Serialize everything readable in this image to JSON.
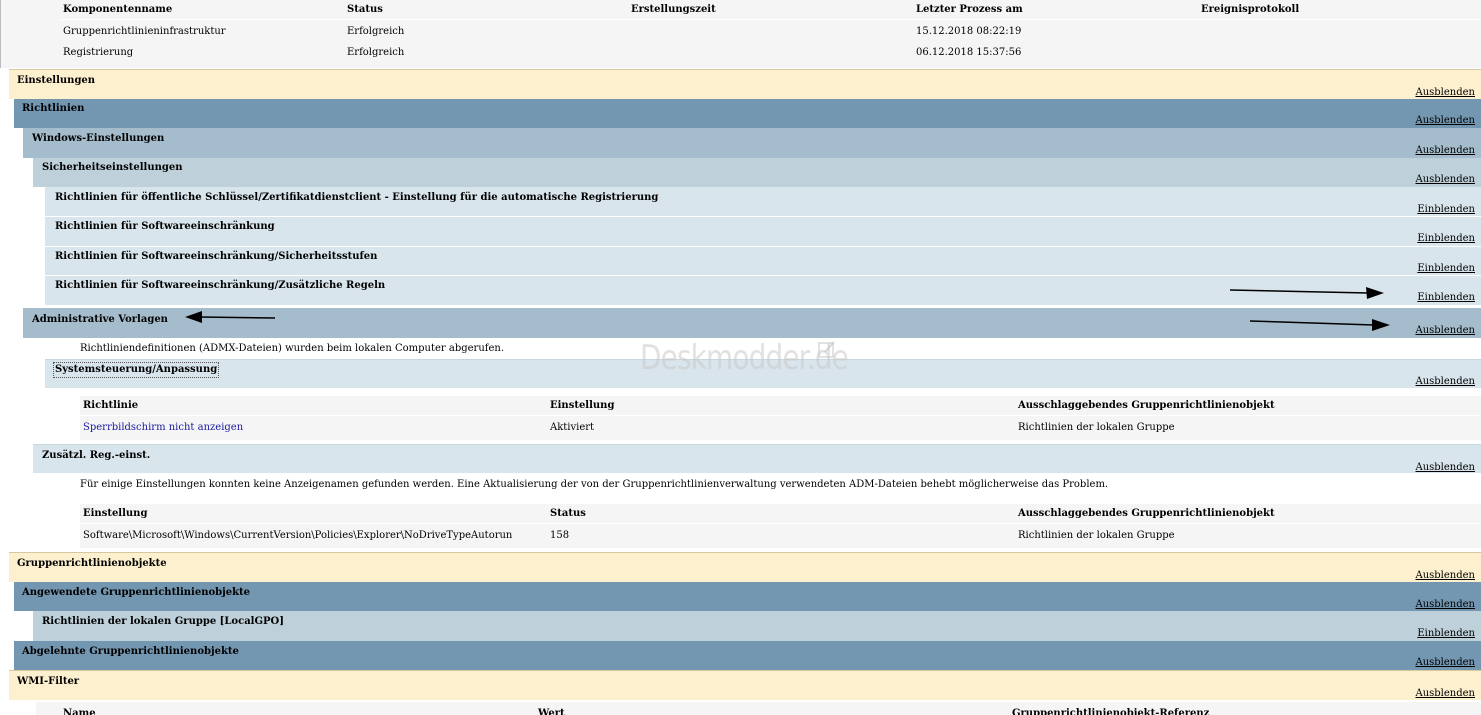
{
  "components": {
    "headers": [
      "Komponentenname",
      "Status",
      "Erstellungszeit",
      "Letzter Prozess am",
      "Ereignisprotokoll"
    ],
    "rows": [
      [
        "Gruppenrichtlinieninfrastruktur",
        "Erfolgreich",
        "",
        "15.12.2018 08:22:19",
        ""
      ],
      [
        "Registrierung",
        "Erfolgreich",
        "",
        "06.12.2018 15:37:56",
        ""
      ]
    ]
  },
  "toggles": {
    "hide": "Ausblenden",
    "show": "Einblenden"
  },
  "sections": {
    "einstellungen": "Einstellungen",
    "richtlinien": "Richtlinien",
    "windows_einstellungen": "Windows-Einstellungen",
    "sicherheitseinstellungen": "Sicherheitseinstellungen",
    "sub1": "Richtlinien für öffentliche Schlüssel/Zertifikatdienstclient - Einstellung für die automatische Registrierung",
    "sub2": "Richtlinien für Softwareeinschränkung",
    "sub3": "Richtlinien für Softwareeinschränkung/Sicherheitsstufen",
    "sub4": "Richtlinien für Softwareeinschränkung/Zusätzliche Regeln",
    "admin_vorlagen": "Administrative Vorlagen",
    "admx_info": "Richtliniendefinitionen (ADMX-Dateien) wurden beim lokalen Computer abgerufen.",
    "systemsteuerung": "Systemsteuerung/Anpassung",
    "zusaetzl": "Zusätzl. Reg.-einst.",
    "zusaetzl_info": "Für einige Einstellungen konnten keine Anzeigenamen gefunden werden. Eine Aktualisierung der von der Gruppenrichtlinienverwaltung verwendeten ADM-Dateien behebt möglicherweise das Problem.",
    "gpo": "Gruppenrichtlinienobjekte",
    "angewendete": "Angewendete Gruppenrichtlinienobjekte",
    "lokale_gruppe": "Richtlinien der lokalen Gruppe [LocalGPO]",
    "abgelehnte": "Abgelehnte Gruppenrichtlinienobjekte",
    "wmi": "WMI-Filter"
  },
  "policy_table": {
    "headers": [
      "Richtlinie",
      "Einstellung",
      "Ausschlaggebendes Gruppenrichtlinienobjekt"
    ],
    "rows": [
      [
        "Sperrbildschirm nicht anzeigen",
        "Aktiviert",
        "Richtlinien der lokalen Gruppe"
      ]
    ]
  },
  "reg_table": {
    "headers": [
      "Einstellung",
      "Status",
      "Ausschlaggebendes Gruppenrichtlinienobjekt"
    ],
    "rows": [
      [
        "Software\\Microsoft\\Windows\\CurrentVersion\\Policies\\Explorer\\NoDriveTypeAutorun",
        "158",
        "Richtlinien der lokalen Gruppe"
      ]
    ]
  },
  "wmi_table": {
    "headers": [
      "Name",
      "Wert",
      "Gruppenrichtlinienobjekt-Referenz"
    ]
  },
  "watermark": "Deskmodder.de",
  "colors": {
    "cream": "#fdf0cf",
    "blue1": "#7396b1",
    "blue2": "#a4bccb",
    "blue3": "#bed0da",
    "blue4": "#d9e5ec",
    "link": "#1a1aa0"
  }
}
